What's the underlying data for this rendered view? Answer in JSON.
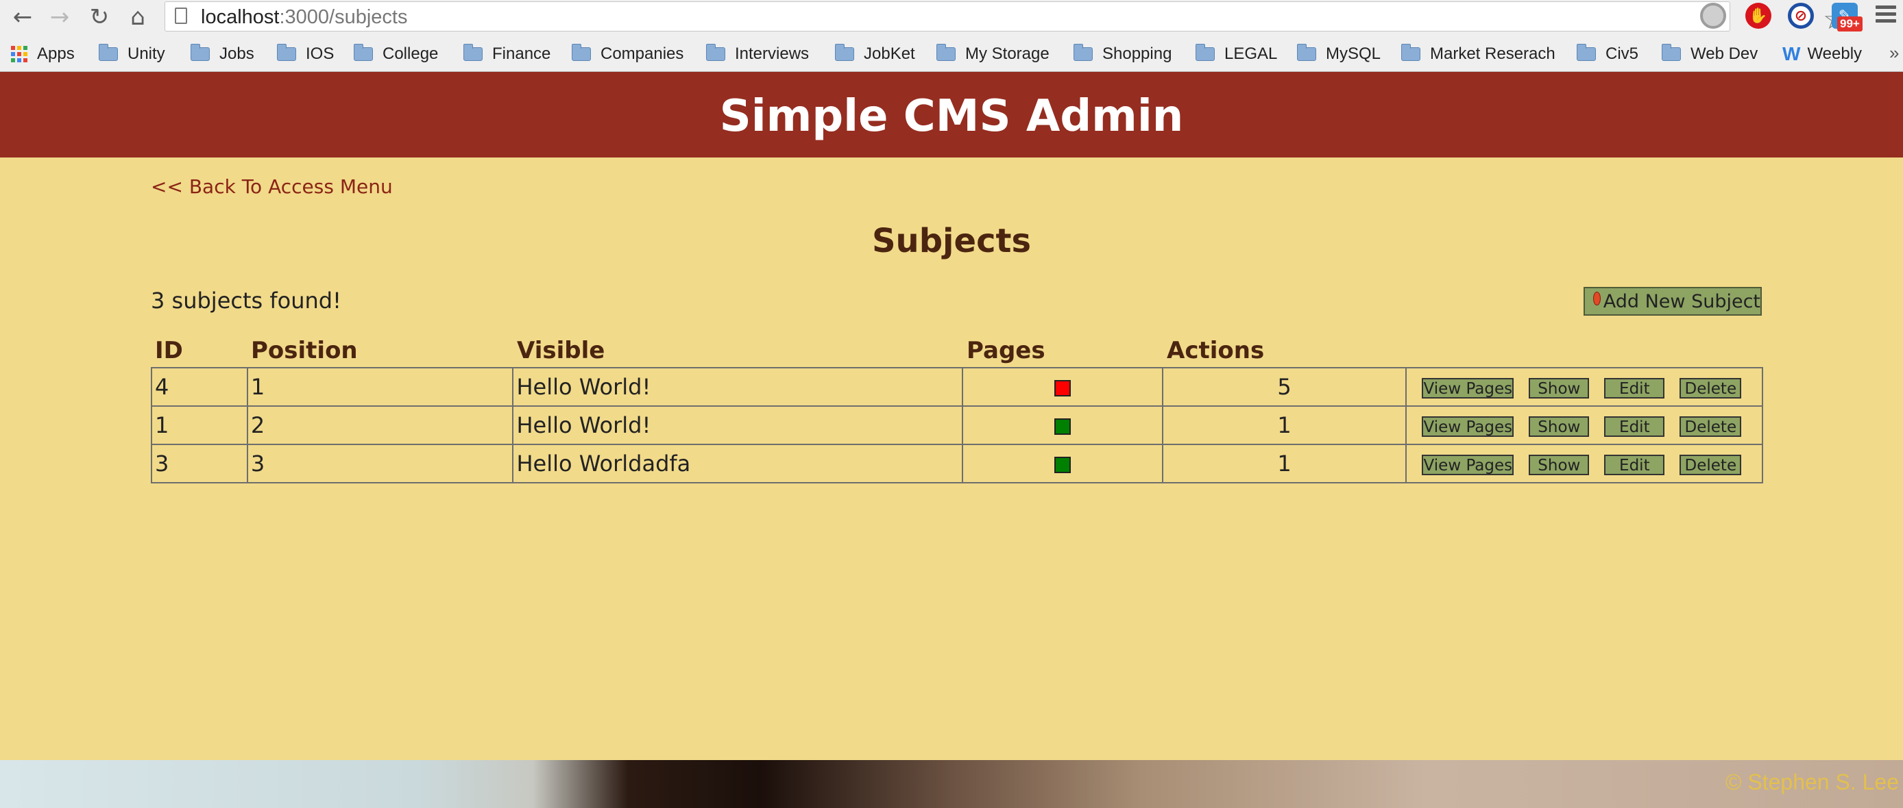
{
  "browser": {
    "url_host": "localhost",
    "url_path": ":3000/subjects",
    "ext_badge": "99+",
    "bookmarks": [
      {
        "label": "Apps",
        "type": "apps"
      },
      {
        "label": "Unity",
        "type": "folder"
      },
      {
        "label": "Jobs",
        "type": "folder"
      },
      {
        "label": "IOS",
        "type": "folder"
      },
      {
        "label": "College",
        "type": "folder"
      },
      {
        "label": "Finance",
        "type": "folder"
      },
      {
        "label": "Companies",
        "type": "folder"
      },
      {
        "label": "Interviews",
        "type": "folder"
      },
      {
        "label": "JobKet",
        "type": "folder"
      },
      {
        "label": "My Storage",
        "type": "folder"
      },
      {
        "label": "Shopping",
        "type": "folder"
      },
      {
        "label": "LEGAL",
        "type": "folder"
      },
      {
        "label": "MySQL",
        "type": "folder"
      },
      {
        "label": "Market Reserach",
        "type": "folder"
      },
      {
        "label": "Civ5",
        "type": "folder"
      },
      {
        "label": "Web Dev",
        "type": "folder"
      },
      {
        "label": "Weebly",
        "type": "weebly"
      }
    ],
    "overflow": "»"
  },
  "header": {
    "title": "Simple CMS Admin"
  },
  "page": {
    "back_link": "<< Back To Access Menu",
    "heading": "Subjects",
    "count_text": "3 subjects found!",
    "add_button": "Add New Subject",
    "columns": {
      "id": "ID",
      "position": "Position",
      "visible": "Visible",
      "pages": "Pages",
      "actions": "Actions"
    },
    "rows": [
      {
        "id": "4",
        "position": "1",
        "name": "Hello World!",
        "visible": false,
        "visible_color": "#ff0000",
        "pages": "5"
      },
      {
        "id": "1",
        "position": "2",
        "name": "Hello World!",
        "visible": true,
        "visible_color": "#008000",
        "pages": "1"
      },
      {
        "id": "3",
        "position": "3",
        "name": "Hello Worldadfa",
        "visible": true,
        "visible_color": "#008000",
        "pages": "1"
      }
    ],
    "actions": {
      "view_pages": "View Pages",
      "show": "Show",
      "edit": "Edit",
      "delete": "Delete"
    }
  },
  "footer": {
    "copyright": "© Stephen S. Lee"
  },
  "colors": {
    "header_bg": "#952d20",
    "page_bg": "#f1da8a",
    "button_bg": "#8ea463",
    "heading_text": "#4b2510",
    "link_text": "#8b2415"
  }
}
